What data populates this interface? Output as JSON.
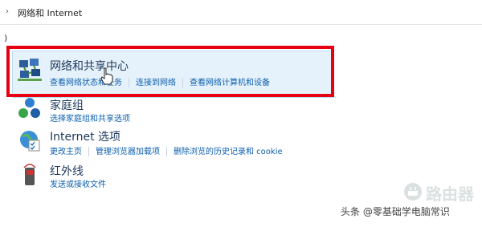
{
  "address_bar": {
    "chevron": "›",
    "breadcrumb": "网络和 Internet"
  },
  "hint_text": ")",
  "items": [
    {
      "icon": "network-sharing-center-icon",
      "title": "网络和共享中心",
      "links": [
        "查看网络状态和任务",
        "连接到网络",
        "查看网络计算机和设备"
      ]
    },
    {
      "icon": "homegroup-icon",
      "title": "家庭组",
      "links": [
        "选择家庭组和共享选项"
      ]
    },
    {
      "icon": "internet-options-icon",
      "title": "Internet 选项",
      "links": [
        "更改主页",
        "管理浏览器加载项",
        "删除浏览的历史记录和 cookie"
      ]
    },
    {
      "icon": "infrared-icon",
      "title": "红外线",
      "links": [
        "发送或接收文件"
      ]
    }
  ],
  "watermark": {
    "text": "头条 @零基础学电脑常识",
    "logo_text": "路由器"
  },
  "colors": {
    "highlight_border": "#e60012",
    "link": "#0c5faf",
    "title": "#1e395b",
    "selected_bg": "#e6f2fb"
  }
}
